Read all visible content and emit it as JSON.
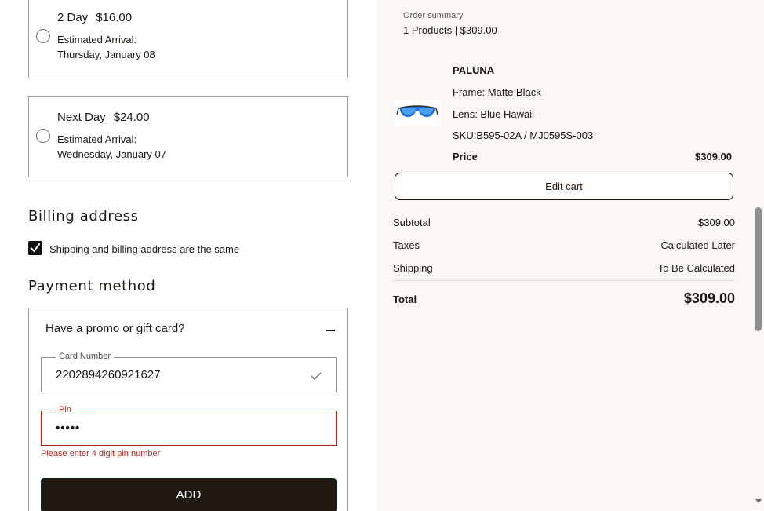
{
  "shipping_options": [
    {
      "name": "2 Day",
      "price": "$16.00",
      "eta_label": "Estimated Arrival:",
      "eta_date": "Thursday, January 08"
    },
    {
      "name": "Next Day",
      "price": "$24.00",
      "eta_label": "Estimated Arrival:",
      "eta_date": "Wednesday, January 07"
    }
  ],
  "billing": {
    "heading": "Billing address",
    "same_as_shipping_label": "Shipping and billing address are the same",
    "same_as_shipping_checked": true
  },
  "payment": {
    "heading": "Payment method",
    "promo_title": "Have a promo or gift card?",
    "card_number_label": "Card Number",
    "card_number_value": "2202894260921627",
    "pin_label": "Pin",
    "pin_value": "•••••",
    "pin_error": "Please enter 4 digit pin number",
    "add_label": "ADD"
  },
  "order_summary": {
    "label": "Order summary",
    "count_text": "1 Products | $309.00",
    "product": {
      "name": "PALUNA",
      "frame": "Frame: Matte Black",
      "lens": "Lens: Blue Hawaii",
      "sku": "SKU:B595-02A / MJ0595S-003",
      "price_label": "Price",
      "price": "$309.00"
    },
    "edit_cart_label": "Edit cart",
    "subtotal_label": "Subtotal",
    "subtotal_value": "$309.00",
    "taxes_label": "Taxes",
    "taxes_value": "Calculated Later",
    "shipping_label": "Shipping",
    "shipping_value": "To Be Calculated",
    "total_label": "Total",
    "total_value": "$309.00"
  },
  "colors": {
    "error": "#b3261e",
    "button_dark": "#1f1811",
    "summary_bg": "#fbf7f5",
    "lens_blue": "#1f6fd6"
  },
  "icons": [
    "radio-icon",
    "checkbox-icon",
    "minus-icon",
    "checkmark-icon",
    "sunglasses-icon",
    "chevron-down-icon"
  ]
}
